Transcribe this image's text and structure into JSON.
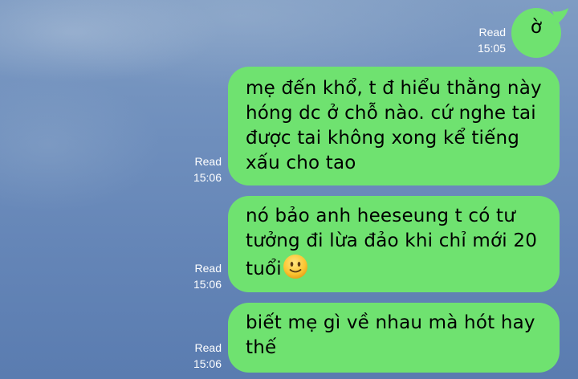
{
  "messages": [
    {
      "text": "ờ",
      "read_label": "Read",
      "time": "15:05"
    },
    {
      "text": "mẹ đến khổ, t đ hiểu thằng này\nhóng dc ở chỗ nào. cứ nghe tai\nđược tai không xong kể tiếng\nxấu cho tao",
      "read_label": "Read",
      "time": "15:06"
    },
    {
      "text": "nó bảo anh heeseung t có tư\ntưởng đi lừa đảo khi chỉ mới 20\ntuổi",
      "emoji": "slightly-smiling-face-icon",
      "read_label": "Read",
      "time": "15:06"
    },
    {
      "text": "biết mẹ gì về nhau mà hót hay\nthế",
      "read_label": "Read",
      "time": "15:06"
    }
  ],
  "colors": {
    "bubble": "#6fe270",
    "text": "#000000",
    "meta": "#ffffff",
    "background": "#6a8bbb"
  }
}
